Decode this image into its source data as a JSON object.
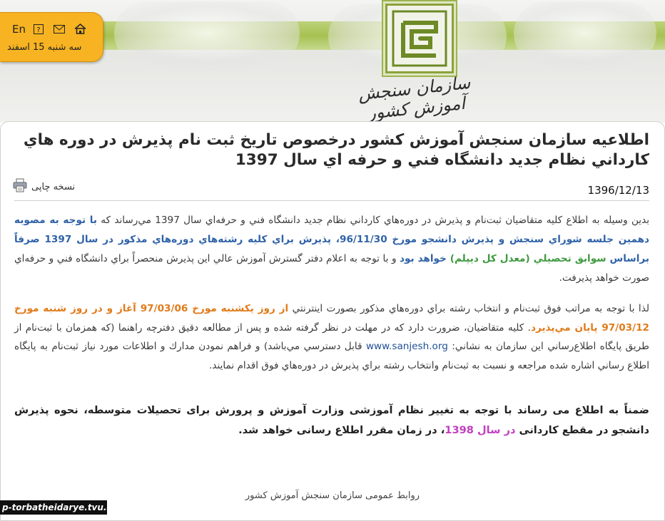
{
  "header": {
    "logo_caption": "سازمان سنجش آموزش کشور"
  },
  "toolbar": {
    "english_label": "En",
    "help_icon": "help-icon",
    "mail_icon": "mail-icon",
    "home_icon": "home-icon",
    "date": "سه شنبه 15 اسفند"
  },
  "article": {
    "title": "اطلاعيه سازمان سنجش آموزش کشور درخصوص تاريخ ثبت نام پذيرش در دوره هاي کارداني نظام جديد دانشگاه فني و حرفه اي سال 1397",
    "print_label": "نسخه چاپی",
    "print_icon": "printer-icon",
    "date": "1396/12/13",
    "p1": {
      "a": "بدين وسيله به اطلاع كليه متقاضيان ثبت‌نام و پذيرش در دوره‌هاي كارداني نظام جديد دانشگاه فني و حرفه‌اي سال 1397 مي‌رساند كه ",
      "b": "با توجه به مصوبه دهمين جلسه شوراي سنجش و پذيرش دانشجو مورخ 96/11/30، پذيرش براي كليه رشته‌هاي دوره‌هاي مذكور در سال 1397 صرفاً براساس ",
      "c": "سوابق تحصيلي (معدل كل ديپلم)",
      "d": " خواهد بود",
      "e": " و با توجه به اعلام دفتر گسترش آموزش عالي اين پذيرش منحصراً براي دانشگاه فني و حرفه‌اي صورت خواهد پذيرفت."
    },
    "p2": {
      "a": "لذا با توجه به مراتب فوق ثبت‌نام و انتخاب رشته براي دوره‌هاي مذكور بصورت اينترنتي ",
      "b": "از روز يكشنبه مورخ 97/03/06 آغاز و در روز شنبه مورخ 97/03/12 پايان مي‌پذيرد",
      "c": ". كليه متقاضيان، ضرورت دارد كه در مهلت در نظر گرفته شده و پس از مطالعه دقيق دفترچه راهنما (كه همزمان با ثبت‌نام از طريق پايگاه اطلاع‌رساني اين سازمان به نشاني: ",
      "url": "www.sanjesh.org",
      "d": " قابل دسترسي مي‌باشد) و فراهم نمودن مدارك و اطلاعات مورد نياز ثبت‌نام به پايگاه اطلاع رساني اشاره شده مراجعه و نسبت به ثبت‌نام وانتخاب رشته براي پذيرش در دوره‌هاي فوق اقدام نمايند."
    },
    "p3": {
      "a": "ضمناً به اطلاع می رساند با توجه به تغییر نظام آموزشی وزارت آموزش و پرورش برای تحصیلات متوسطه، نحوه پذیرش دانشجو در مقطع کاردانی ",
      "b": "در سال 1398",
      "c": "، در زمان مقرر اطلاع رسانی خواهد شد."
    },
    "footer": "روابط عمومی سازمان سنجش آموزش کشور"
  },
  "watermark": "p-torbatheidarye.tvu.ac.ir",
  "colors": {
    "accent_green": "#a7c152",
    "toolbar_orange": "#f7b321",
    "link_blue": "#2f62a8",
    "highlight_green": "#3f9a3f",
    "highlight_orange": "#e07b1a",
    "highlight_purple": "#c240c0"
  }
}
